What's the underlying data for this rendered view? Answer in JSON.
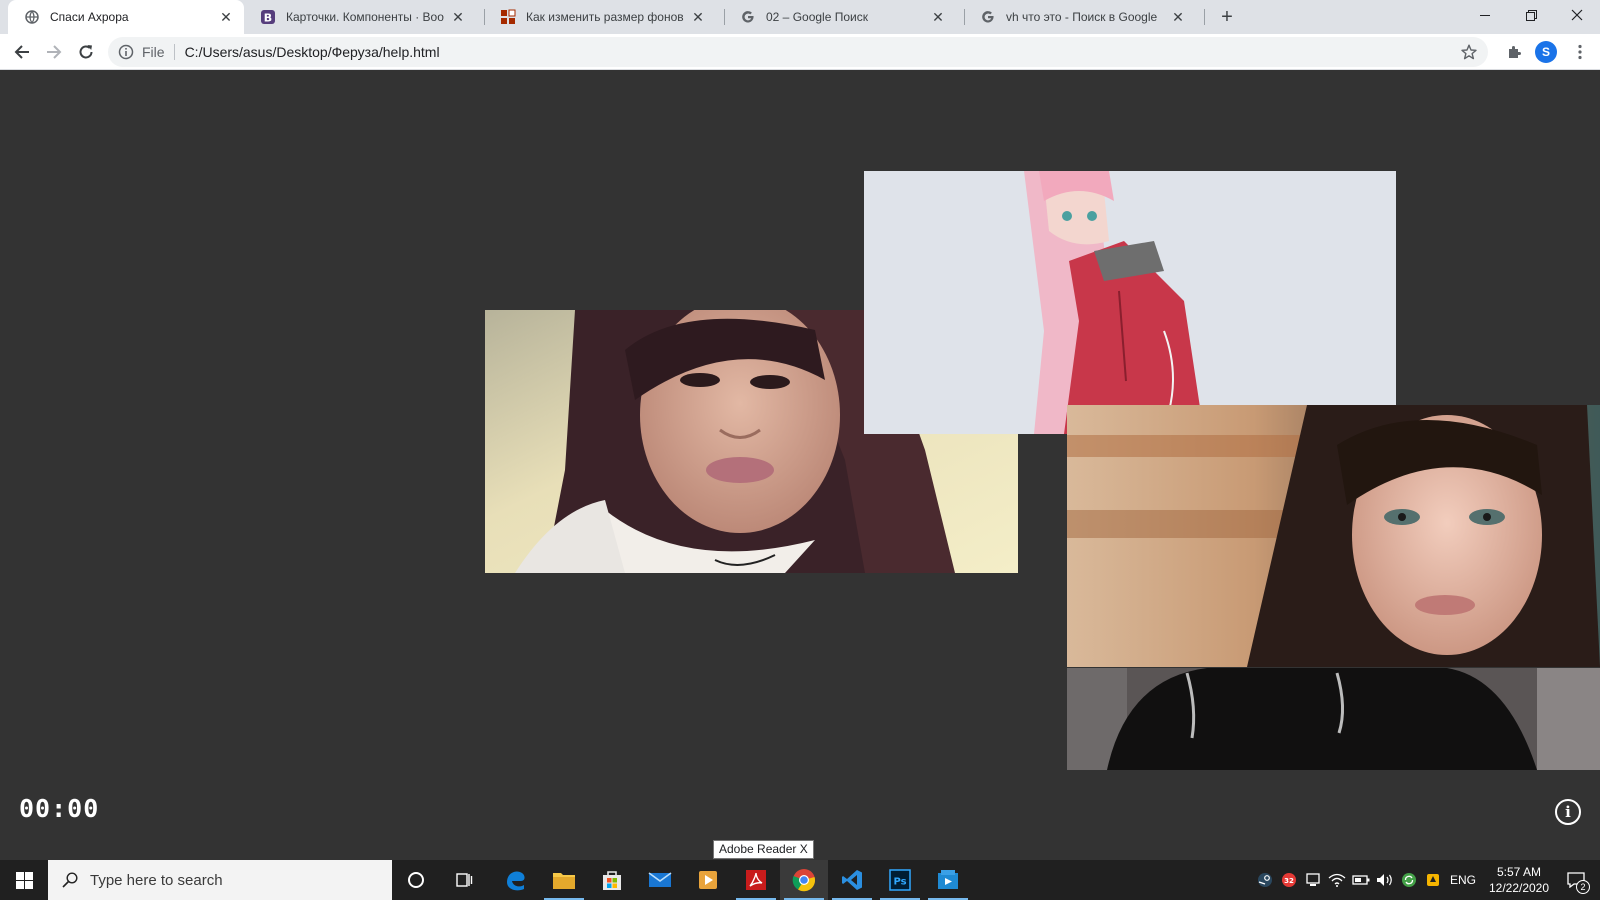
{
  "browser": {
    "tabs": [
      {
        "title": "Спаси Ахрора",
        "icon": "globe-icon",
        "active": true
      },
      {
        "title": "Карточки. Компоненты · Bootstrap",
        "icon": "bootstrap-icon",
        "active": false
      },
      {
        "title": "Как изменить размер фоновой",
        "icon": "htmlbook-icon",
        "active": false
      },
      {
        "title": "02 – Google Поиск",
        "icon": "google-icon",
        "active": false
      },
      {
        "title": "vh что это - Поиск в Google",
        "icon": "google-icon",
        "active": false
      }
    ],
    "new_tab_label": "+",
    "address": {
      "scheme": "File",
      "url": "C:/Users/asus/Desktop/Феруза/help.html"
    },
    "profile_initial": "S"
  },
  "page": {
    "timer": "00:00",
    "info_button": "i"
  },
  "tooltip": "Adobe Reader X",
  "taskbar": {
    "search_placeholder": "Type here to search",
    "apps": [
      "cortana-icon",
      "task-view-icon",
      "edge-icon",
      "file-explorer-icon",
      "store-icon",
      "mail-icon",
      "media-player-icon",
      "adobe-reader-icon",
      "chrome-icon",
      "vscode-icon",
      "photoshop-icon",
      "remote-app-icon"
    ],
    "tray": {
      "badge_count": "32",
      "language": "ENG",
      "time": "5:57 AM",
      "date": "12/22/2020",
      "notifications": "2"
    }
  },
  "colors": {
    "page_background": "#333333",
    "tab_strip": "#dee1e6",
    "taskbar": "#202020",
    "accent": "#1a73e8"
  }
}
